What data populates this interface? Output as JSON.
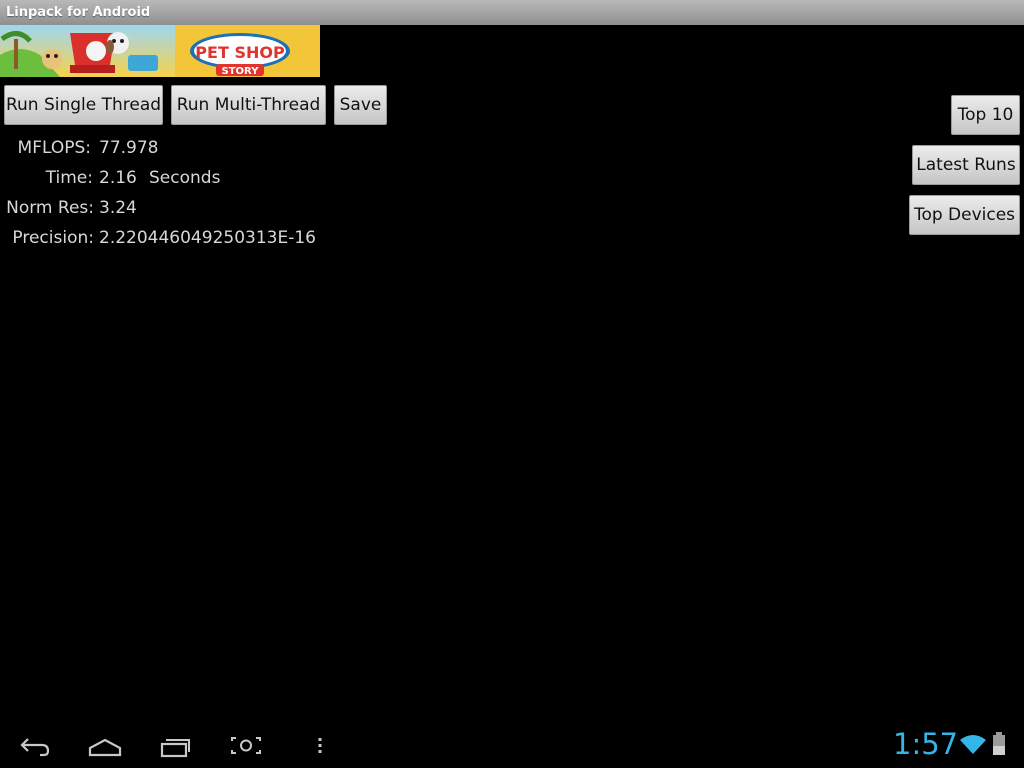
{
  "window": {
    "title": "Linpack for Android"
  },
  "ad": {
    "brand_line1": "PET SHOP",
    "brand_line2": "STORY"
  },
  "toolbar": {
    "run_single_label": "Run Single Thread",
    "run_multi_label": "Run Multi-Thread",
    "save_label": "Save"
  },
  "side_buttons": {
    "top10_label": "Top 10",
    "latest_runs_label": "Latest Runs",
    "top_devices_label": "Top Devices"
  },
  "results": {
    "mflops_label": "MFLOPS:",
    "mflops_value": "77.978",
    "time_label": "Time:",
    "time_value": "2.16",
    "time_unit": "Seconds",
    "normres_label": "Norm Res:",
    "normres_value": "3.24",
    "precision_label": "Precision:",
    "precision_value": "2.220446049250313E-16"
  },
  "status_bar": {
    "clock": "1:57",
    "accent_color": "#33b5e5",
    "icons": [
      "back-icon",
      "home-icon",
      "recent-apps-icon",
      "screenshot-icon",
      "menu-icon",
      "wifi-icon",
      "battery-icon"
    ]
  }
}
